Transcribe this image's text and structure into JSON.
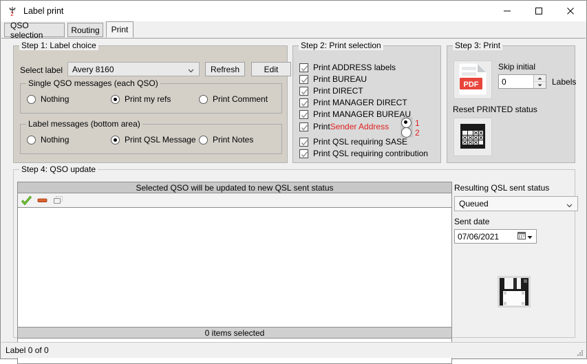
{
  "window": {
    "title": "Label print",
    "icon": "antenna-icon",
    "controls": {
      "minimize": "minimize-icon",
      "maximize": "maximize-icon",
      "close": "close-icon"
    }
  },
  "tabs": [
    {
      "label": "QSO selection",
      "selected": false
    },
    {
      "label": "Routing",
      "selected": false
    },
    {
      "label": "Print",
      "selected": true
    }
  ],
  "step1": {
    "title": "Step 1: Label choice",
    "select_label": "Select label",
    "label_combo_value": "Avery 8160",
    "refresh_button": "Refresh",
    "edit_button": "Edit",
    "single_qso": {
      "title": "Single QSO messages (each QSO)",
      "options": [
        {
          "label": "Nothing",
          "selected": false
        },
        {
          "label": "Print my refs",
          "selected": true
        },
        {
          "label": "Print Comment",
          "selected": false
        }
      ]
    },
    "label_messages": {
      "title": "Label messages (bottom area)",
      "options": [
        {
          "label": "Nothing",
          "selected": false
        },
        {
          "label": "Print QSL Message",
          "selected": true
        },
        {
          "label": "Print Notes",
          "selected": false
        }
      ]
    }
  },
  "step2": {
    "title": "Step 2: Print selection",
    "items": [
      {
        "label": "Print ADDRESS labels",
        "checked": true
      },
      {
        "label": "Print BUREAU",
        "checked": true
      },
      {
        "label": "Print DIRECT",
        "checked": true
      },
      {
        "label": "Print MANAGER DIRECT",
        "checked": true
      },
      {
        "label": "Print MANAGER BUREAU",
        "checked": true
      },
      {
        "label": "Print ",
        "label_red": "Sender Address",
        "checked": true
      },
      {
        "label": "Print QSL requiring SASE",
        "checked": true
      },
      {
        "label": "Print QSL requiring contribution",
        "checked": true
      }
    ],
    "sender_copies": [
      {
        "label": "1",
        "selected": true
      },
      {
        "label": "2",
        "selected": false
      }
    ]
  },
  "step3": {
    "title": "Step 3: Print",
    "pdf_button": "pdf-icon",
    "skip_initial_label": "Skip initial",
    "skip_initial_value": "0",
    "labels_label": "Labels",
    "reset_label": "Reset PRINTED status",
    "reset_button": "calendar-grid-icon"
  },
  "step4": {
    "title": "Step 4: QSO update",
    "list_header": "Selected QSO will be updated to new QSL sent status",
    "toolbar": [
      {
        "name": "check-all-icon"
      },
      {
        "name": "uncheck-all-icon"
      },
      {
        "name": "copy-icon"
      }
    ],
    "list_footer": "0 items selected"
  },
  "right_panel": {
    "status_label": "Resulting QSL sent status",
    "status_value": "Queued",
    "sent_date_label": "Sent date",
    "sent_date_value": "07/06/2021",
    "save_button": "floppy-disk-icon"
  },
  "statusbar": {
    "text": "Label  0  of  0"
  },
  "colors": {
    "accent_red": "#e02020",
    "pdf_red": "#e8453c",
    "panel": "#d4d0c8",
    "window_bg": "#f0f0f0",
    "check_gray": "#8c8c8c",
    "green_check": "#57a820"
  }
}
